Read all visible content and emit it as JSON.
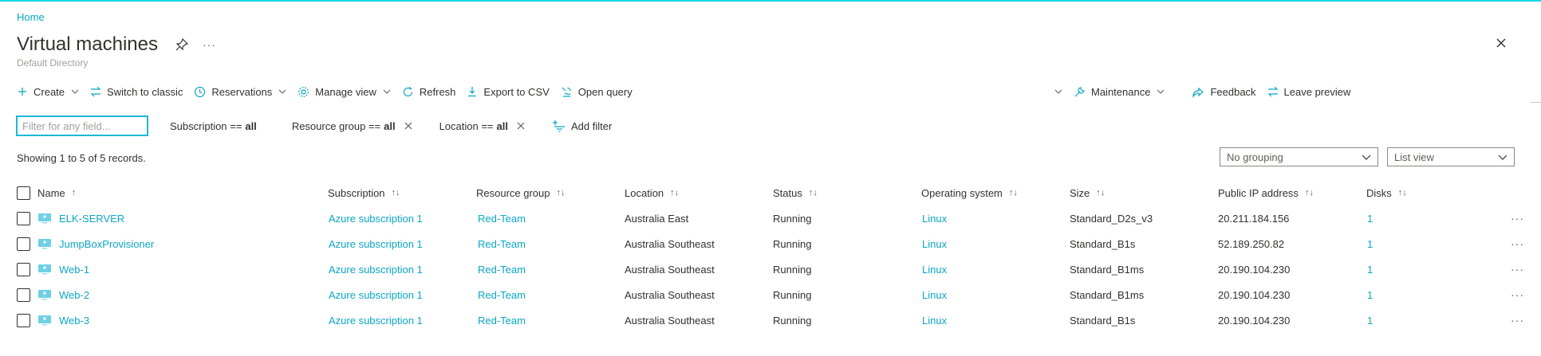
{
  "colors": {
    "accent": "#0aa7c4",
    "topline": "#1cd8e6",
    "text": "#323130",
    "muted": "#a19f9d"
  },
  "breadcrumb": "Home",
  "page": {
    "title": "Virtual machines",
    "subtitle": "Default Directory",
    "more": "···"
  },
  "icons": [
    "pin-icon",
    "close-icon",
    "plus-icon",
    "switch-icon",
    "clock-icon",
    "gear-icon",
    "refresh-icon",
    "download-icon",
    "query-icon",
    "wrench-icon",
    "feedback-icon",
    "filter-add-icon",
    "chevron-down-icon",
    "vm-icon"
  ],
  "toolbar": {
    "create": "Create",
    "switch_classic": "Switch to classic",
    "reservations": "Reservations",
    "manage_view": "Manage view",
    "refresh": "Refresh",
    "export_csv": "Export to CSV",
    "open_query": "Open query",
    "maintenance": "Maintenance",
    "feedback": "Feedback",
    "leave_preview": "Leave preview"
  },
  "filters": {
    "placeholder": "Filter for any field...",
    "subscription": {
      "label": "Subscription ==",
      "value": "all"
    },
    "resource_group": {
      "label": "Resource group ==",
      "value": "all"
    },
    "location": {
      "label": "Location ==",
      "value": "all"
    },
    "add_filter": "Add filter"
  },
  "records": "Showing 1 to 5 of 5 records.",
  "grouping": "No grouping",
  "view": "List view",
  "columns": {
    "name": "Name",
    "name_sort": "↑",
    "subscription": "Subscription",
    "resource_group": "Resource group",
    "location": "Location",
    "status": "Status",
    "os": "Operating system",
    "size": "Size",
    "public_ip": "Public IP address",
    "disks": "Disks",
    "sort": "↑↓"
  },
  "rows": [
    {
      "name": "ELK-SERVER",
      "subscription": "Azure subscription 1",
      "resource_group": "Red-Team",
      "location": "Australia East",
      "status": "Running",
      "os": "Linux",
      "size": "Standard_D2s_v3",
      "ip": "20.211.184.156",
      "disks": "1",
      "more": "···"
    },
    {
      "name": "JumpBoxProvisioner",
      "subscription": "Azure subscription 1",
      "resource_group": "Red-Team",
      "location": "Australia Southeast",
      "status": "Running",
      "os": "Linux",
      "size": "Standard_B1s",
      "ip": "52.189.250.82",
      "disks": "1",
      "more": "···"
    },
    {
      "name": "Web-1",
      "subscription": "Azure subscription 1",
      "resource_group": "Red-Team",
      "location": "Australia Southeast",
      "status": "Running",
      "os": "Linux",
      "size": "Standard_B1ms",
      "ip": "20.190.104.230",
      "disks": "1",
      "more": "···"
    },
    {
      "name": "Web-2",
      "subscription": "Azure subscription 1",
      "resource_group": "Red-Team",
      "location": "Australia Southeast",
      "status": "Running",
      "os": "Linux",
      "size": "Standard_B1ms",
      "ip": "20.190.104.230",
      "disks": "1",
      "more": "···"
    },
    {
      "name": "Web-3",
      "subscription": "Azure subscription 1",
      "resource_group": "Red-Team",
      "location": "Australia Southeast",
      "status": "Running",
      "os": "Linux",
      "size": "Standard_B1s",
      "ip": "20.190.104.230",
      "disks": "1",
      "more": "···"
    }
  ]
}
